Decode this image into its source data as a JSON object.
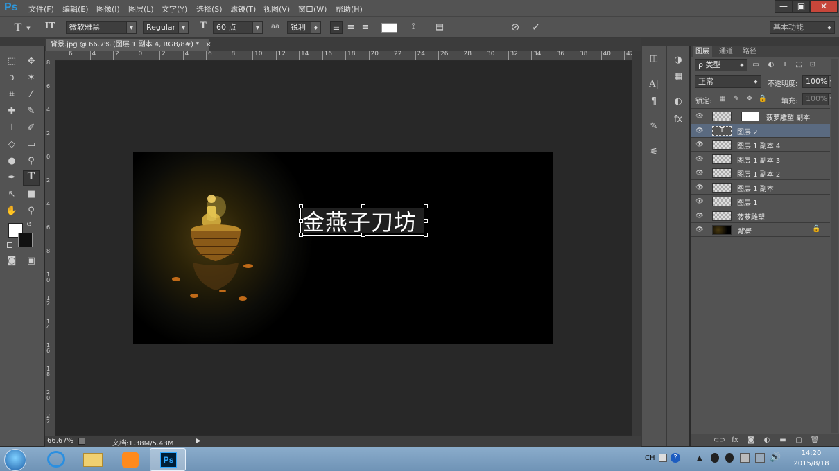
{
  "app": {
    "logo": "Ps"
  },
  "menu": [
    "文件(F)",
    "编辑(E)",
    "图像(I)",
    "图层(L)",
    "文字(Y)",
    "选择(S)",
    "滤镜(T)",
    "视图(V)",
    "窗口(W)",
    "帮助(H)"
  ],
  "window_controls": {
    "minimize": "—",
    "restore": "▣",
    "close": "✕"
  },
  "options": {
    "tool_glyph": "T",
    "orientation_glyph": "IT",
    "font_family": "微软雅黑",
    "font_style": "Regular",
    "size_glyph": "T",
    "font_size": "60 点",
    "aa_glyph": "aa",
    "antialias": "锐利",
    "color_swatch": "#ffffff",
    "workspace": "基本功能"
  },
  "document": {
    "tab_title": "背景.jpg @ 66.7% (图层 1 副本 4, RGB/8#) *",
    "tab_close": "×",
    "text_layer_content": "金燕子刀坊",
    "ruler_labels": [
      "6",
      "4",
      "2",
      "0",
      "2",
      "4",
      "6",
      "8",
      "10",
      "12",
      "14",
      "16",
      "18",
      "20",
      "22",
      "24",
      "26",
      "28",
      "30",
      "32",
      "34",
      "36",
      "38",
      "40",
      "42"
    ],
    "vruler_labels": [
      "8",
      "6",
      "4",
      "2",
      "0",
      "2",
      "4",
      "6",
      "8",
      "1\n0",
      "1\n2",
      "1\n4",
      "1\n6",
      "1\n8",
      "2\n0",
      "2\n2"
    ]
  },
  "status": {
    "zoom": "66.67%",
    "doc_info": "文档:1.38M/5.43M",
    "play_glyph": "▶"
  },
  "layers_panel": {
    "tabs": [
      "图层",
      "通道",
      "路径"
    ],
    "filter_kind": "ρ 类型",
    "blend_mode": "正常",
    "opacity_label": "不透明度:",
    "opacity_value": "100%",
    "lock_label": "锁定:",
    "fill_label": "填充:",
    "fill_value": "100%",
    "layers": [
      {
        "name": "菠萝雕塑 副本",
        "selected": false,
        "type": "masked"
      },
      {
        "name": "图层 2",
        "selected": true,
        "type": "text"
      },
      {
        "name": "图层 1 副本 4",
        "selected": false,
        "type": "pixel"
      },
      {
        "name": "图层 1 副本 3",
        "selected": false,
        "type": "pixel"
      },
      {
        "name": "图层 1 副本 2",
        "selected": false,
        "type": "pixel"
      },
      {
        "name": "图层 1 副本",
        "selected": false,
        "type": "pixel"
      },
      {
        "name": "图层 1",
        "selected": false,
        "type": "pixel"
      },
      {
        "name": "菠萝雕塑",
        "selected": false,
        "type": "pixel"
      },
      {
        "name": "背景",
        "selected": false,
        "type": "background"
      }
    ]
  },
  "taskbar": {
    "lang": "CH",
    "time": "14:20",
    "date": "2015/8/18",
    "ps_label": "Ps"
  },
  "colors": {
    "accent": "#2f96d8",
    "panel": "#535353",
    "selected_layer": "#5a6a80"
  }
}
